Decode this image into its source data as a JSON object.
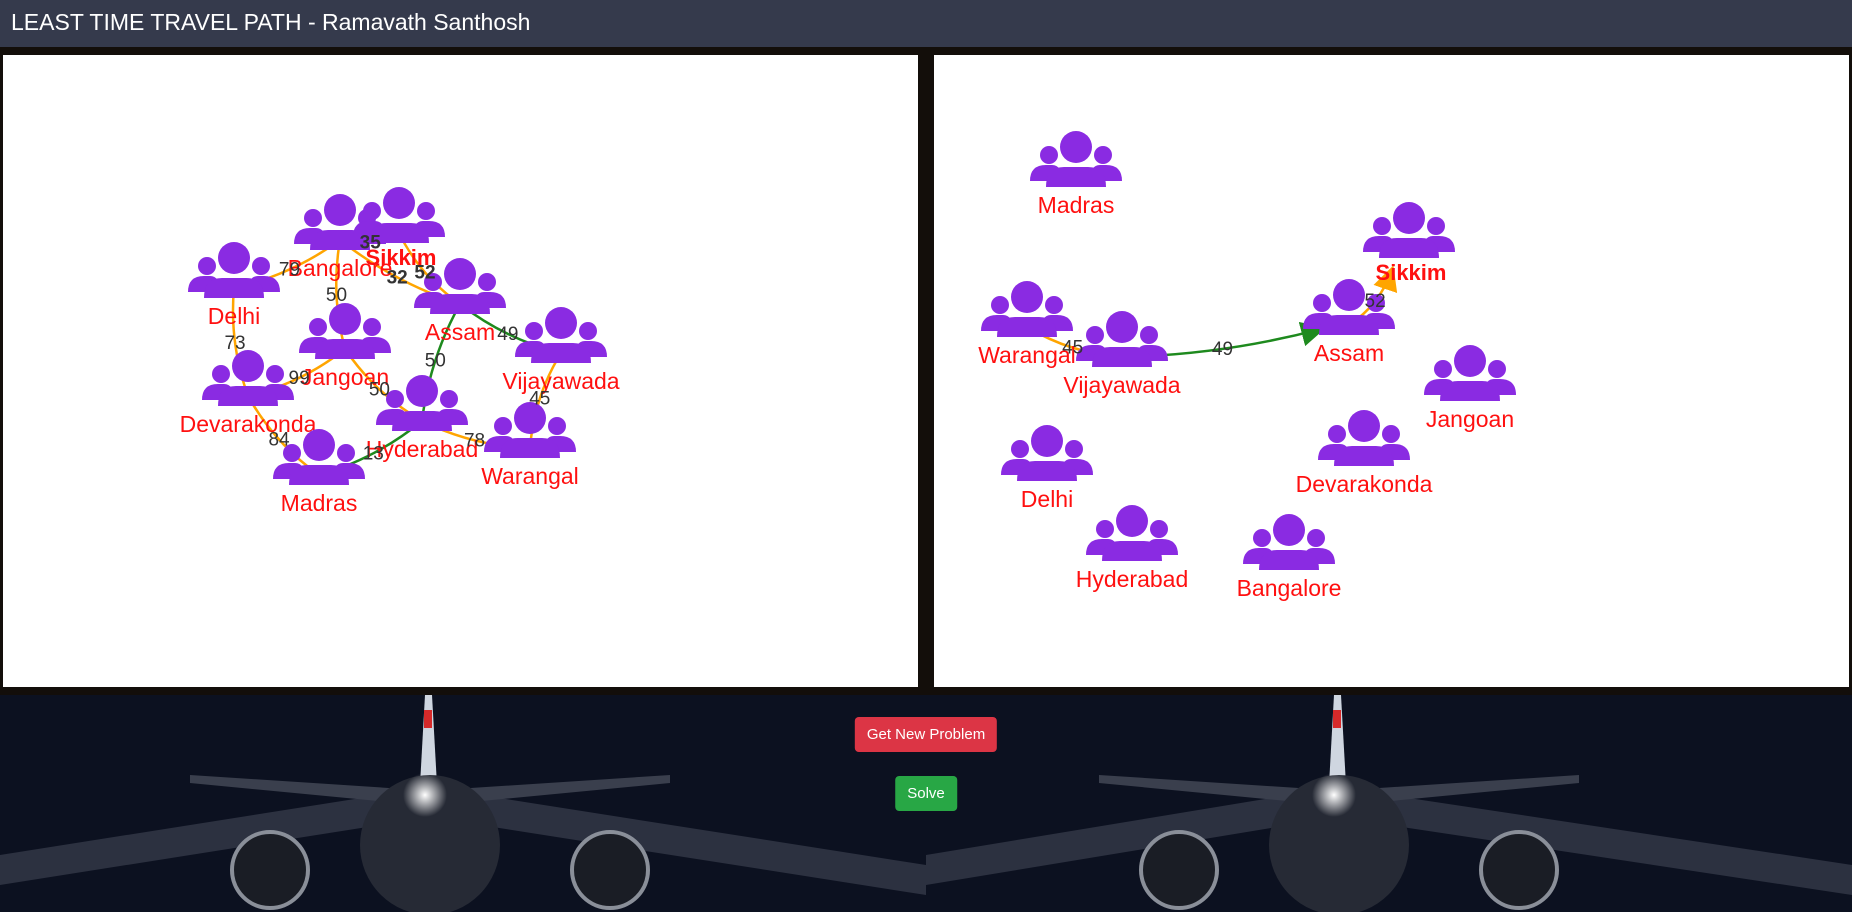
{
  "header": {
    "title": "LEAST TIME TRAVEL PATH - Ramavath Santhosh"
  },
  "colors": {
    "header_bg": "#353a4c",
    "node_icon": "#8a2be2",
    "node_label": "#ff1010",
    "edge_default": "#ffa500",
    "edge_path": "#1e8a1e",
    "button_new": "#dc3545",
    "button_solve": "#28a745"
  },
  "icons": {
    "node": "group-of-people-icon"
  },
  "problem_graph": {
    "nodes": [
      {
        "id": "Bangalore",
        "label": "Bangalore"
      },
      {
        "id": "Sikkim",
        "label": "Sikkim",
        "destination": true
      },
      {
        "id": "Delhi",
        "label": "Delhi"
      },
      {
        "id": "Assam",
        "label": "Assam"
      },
      {
        "id": "Jangoan",
        "label": "Jangoan"
      },
      {
        "id": "Vijayawada",
        "label": "Vijayawada"
      },
      {
        "id": "Devarakonda",
        "label": "Devarakonda"
      },
      {
        "id": "Hyderabad",
        "label": "Hyderabad"
      },
      {
        "id": "Warangal",
        "label": "Warangal"
      },
      {
        "id": "Madras",
        "label": "Madras"
      }
    ],
    "edges": [
      {
        "from": "Bangalore",
        "to": "Sikkim",
        "weight": "35",
        "bold": true
      },
      {
        "from": "Delhi",
        "to": "Bangalore",
        "weight": "79"
      },
      {
        "from": "Bangalore",
        "to": "Assam",
        "weight": "32",
        "bold": true
      },
      {
        "from": "Sikkim",
        "to": "Assam",
        "weight": "52",
        "bold": true
      },
      {
        "from": "Bangalore",
        "to": "Jangoan",
        "weight": "50"
      },
      {
        "from": "Delhi",
        "to": "Devarakonda",
        "weight": "73"
      },
      {
        "from": "Devarakonda",
        "to": "Jangoan",
        "weight": "99"
      },
      {
        "from": "Assam",
        "to": "Vijayawada",
        "weight": "49",
        "path": true
      },
      {
        "from": "Assam",
        "to": "Hyderabad",
        "weight": "50",
        "path": true
      },
      {
        "from": "Jangoan",
        "to": "Hyderabad",
        "weight": "50"
      },
      {
        "from": "Vijayawada",
        "to": "Warangal",
        "weight": "45"
      },
      {
        "from": "Hyderabad",
        "to": "Warangal",
        "weight": "78"
      },
      {
        "from": "Devarakonda",
        "to": "Madras",
        "weight": "84"
      },
      {
        "from": "Madras",
        "to": "Hyderabad",
        "weight": "13",
        "path": true
      }
    ]
  },
  "solution_graph": {
    "nodes": [
      {
        "id": "Madras",
        "label": "Madras"
      },
      {
        "id": "Sikkim",
        "label": "Sikkim",
        "destination": true
      },
      {
        "id": "Warangal",
        "label": "Warangal"
      },
      {
        "id": "Assam",
        "label": "Assam"
      },
      {
        "id": "Vijayawada",
        "label": "Vijayawada"
      },
      {
        "id": "Jangoan",
        "label": "Jangoan"
      },
      {
        "id": "Devarakonda",
        "label": "Devarakonda"
      },
      {
        "id": "Delhi",
        "label": "Delhi"
      },
      {
        "id": "Hyderabad",
        "label": "Hyderabad"
      },
      {
        "id": "Bangalore",
        "label": "Bangalore"
      }
    ],
    "edges": [
      {
        "from": "Warangal",
        "to": "Vijayawada",
        "weight": "45"
      },
      {
        "from": "Vijayawada",
        "to": "Assam",
        "weight": "49",
        "path": true,
        "arrow": true
      },
      {
        "from": "Assam",
        "to": "Sikkim",
        "weight": "52",
        "arrow": true
      }
    ]
  },
  "buttons": {
    "new_problem": "Get New Problem",
    "solve": "Solve"
  }
}
